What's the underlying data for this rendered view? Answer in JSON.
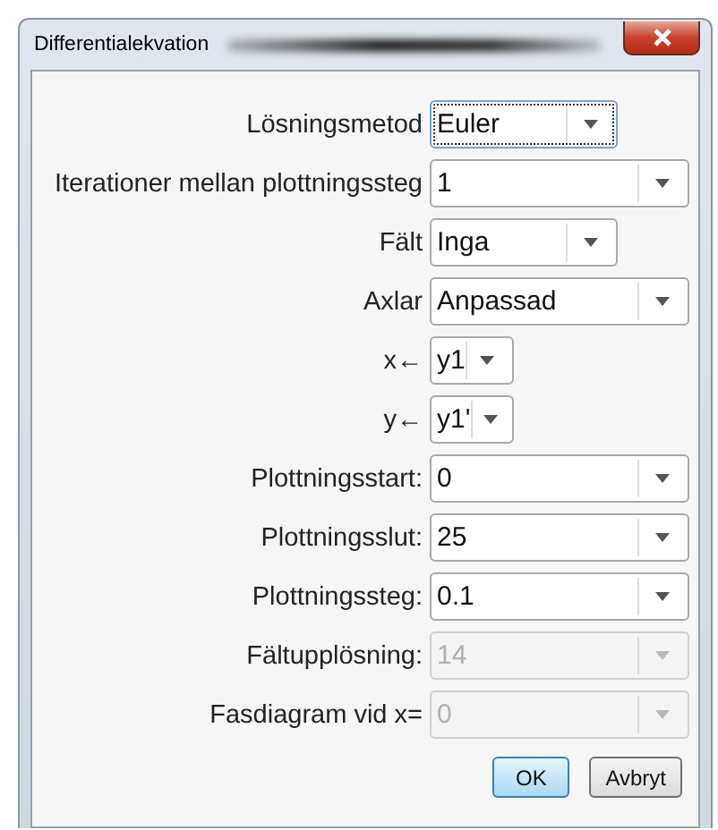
{
  "window": {
    "title": "Differentialekvation"
  },
  "fields": [
    {
      "label": "Lösningsmetod",
      "value": "Euler",
      "kind": "medium",
      "disabled": false,
      "focused": true
    },
    {
      "label": "Iterationer mellan plottningssteg",
      "value": "1",
      "kind": "wide",
      "disabled": false,
      "focused": false
    },
    {
      "label": "Fält",
      "value": "Inga",
      "kind": "medium",
      "disabled": false,
      "focused": false
    },
    {
      "label": "Axlar",
      "value": "Anpassad",
      "kind": "wide",
      "disabled": false,
      "focused": false
    },
    {
      "label": "x←",
      "value": "y1",
      "kind": "narrow",
      "disabled": false,
      "focused": false
    },
    {
      "label": "y←",
      "value": "y1'",
      "kind": "narrow",
      "disabled": false,
      "focused": false
    },
    {
      "label": "Plottningsstart:",
      "value": "0",
      "kind": "wide",
      "disabled": false,
      "focused": false
    },
    {
      "label": "Plottningsslut:",
      "value": "25",
      "kind": "wide",
      "disabled": false,
      "focused": false
    },
    {
      "label": "Plottningssteg:",
      "value": "0.1",
      "kind": "wide",
      "disabled": false,
      "focused": false
    },
    {
      "label": "Fältupplösning:",
      "value": "14",
      "kind": "wide",
      "disabled": true,
      "focused": false
    },
    {
      "label": "Fasdiagram vid x=",
      "value": "0",
      "kind": "wide",
      "disabled": true,
      "focused": false
    }
  ],
  "buttons": [
    {
      "label": "OK",
      "kind": "default"
    },
    {
      "label": "Avbryt",
      "kind": "normal"
    }
  ]
}
